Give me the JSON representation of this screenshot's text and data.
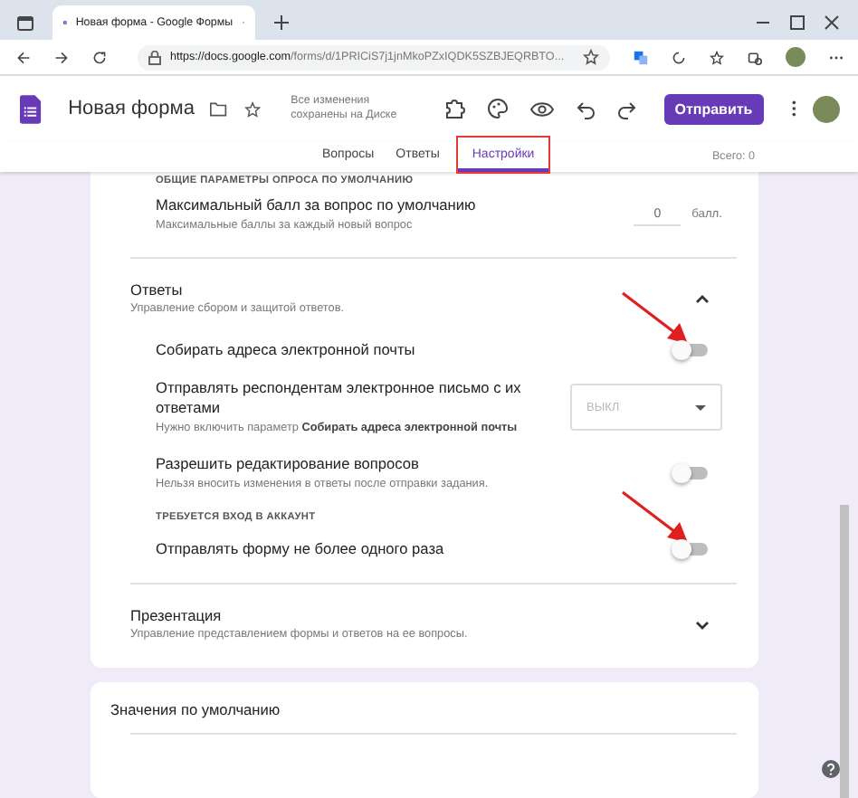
{
  "browser": {
    "tab_title": "Новая форма - Google Формы",
    "url_host": "https://docs.google.com",
    "url_path": "/forms/d/1PRICiS7j1jnMkoPZxIQDK5SZBJEQRBTO..."
  },
  "header": {
    "title": "Новая форма",
    "save_status": "Все изменения сохранены на Диске",
    "send_button": "Отправить"
  },
  "tabs": [
    {
      "label": "Вопросы",
      "selected": false,
      "highlighted": false
    },
    {
      "label": "Ответы",
      "selected": false,
      "highlighted": false
    },
    {
      "label": "Настройки",
      "selected": true,
      "highlighted": true
    }
  ],
  "total": "Всего: 0",
  "quiz_defaults": {
    "heading": "ОБЩИЕ ПАРАМЕТРЫ ОПРОСА ПО УМОЛЧАНИЮ",
    "title": "Максимальный балл за вопрос по умолчанию",
    "subtitle": "Максимальные баллы за каждый новый вопрос",
    "value": "0",
    "unit": "балл."
  },
  "responses": {
    "title": "Ответы",
    "subtitle": "Управление сбором и защитой ответов.",
    "expanded": true,
    "items": [
      {
        "kind": "toggle",
        "title": "Собирать адреса электронной почты",
        "on": false,
        "arrow": true
      },
      {
        "kind": "select",
        "title": "Отправлять респондентам электронное письмо с их ответами",
        "hint": "Нужно включить параметр **Собирать адреса электронной почты**",
        "value": "ВЫКЛ",
        "disabled": true
      },
      {
        "kind": "toggle",
        "title": "Разрешить редактирование вопросов",
        "subtitle": "Нельзя вносить изменения в ответы после отправки задания.",
        "on": false,
        "arrow": false
      },
      {
        "kind": "heading",
        "title": "ТРЕБУЕТСЯ ВХОД В АККАУНТ"
      },
      {
        "kind": "toggle",
        "title": "Отправлять форму не более одного раза",
        "on": false,
        "arrow": true
      }
    ]
  },
  "presentation": {
    "title": "Презентация",
    "subtitle": "Управление представлением формы и ответов на ее вопросы.",
    "expanded": false
  },
  "defaults": {
    "title": "Значения по умолчанию"
  }
}
